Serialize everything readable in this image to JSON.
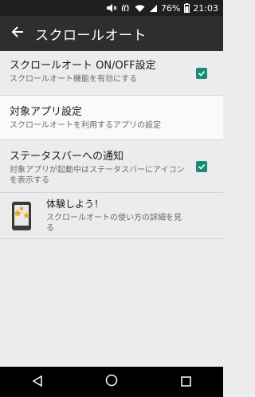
{
  "status_bar": {
    "battery": "76%",
    "time": "21:03"
  },
  "app_bar": {
    "title": "スクロールオート"
  },
  "settings": [
    {
      "title": "スクロールオート ON/OFF設定",
      "subtitle": "スクロールオート機能を有効にする",
      "checked": true
    },
    {
      "title": "対象アプリ設定",
      "subtitle": "スクロールオートを利用するアプリの設定",
      "checked": false
    },
    {
      "title": "ステータスバーへの通知",
      "subtitle": "対象アプリが起動中はステータスバーにアイコンを表示する",
      "checked": true
    }
  ],
  "experience": {
    "title": "体験しよう！",
    "subtitle": "スクロールオートの使い方の詳細を見る"
  },
  "colors": {
    "accent": "#1d8a78",
    "app_bar": "#2e2e2e",
    "status_bar": "#1f1f1f"
  },
  "icons": [
    "mute-icon",
    "nfc-icon",
    "wifi-icon",
    "signal-icon",
    "battery-icon",
    "back-arrow-icon",
    "checkbox-checked-icon",
    "tablet-stars-icon",
    "nav-back-icon",
    "nav-home-icon",
    "nav-recent-icon"
  ]
}
